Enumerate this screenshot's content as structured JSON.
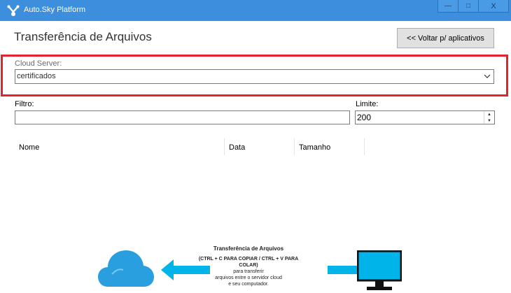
{
  "window": {
    "title": "Auto.Sky Platform",
    "minimize_glyph": "—",
    "maximize_glyph": "□",
    "close_glyph": "X"
  },
  "page": {
    "title": "Transferência de Arquivos",
    "back_button": "<< Voltar p/ aplicativos"
  },
  "cloud_server": {
    "label": "Cloud Server:",
    "selected": "certificados"
  },
  "filter": {
    "label": "Filtro:",
    "value": ""
  },
  "limit": {
    "label": "Limite:",
    "value": "200"
  },
  "file_list": {
    "columns": [
      "Nome",
      "Data",
      "Tamanho"
    ]
  },
  "info": {
    "title": "Transferência de Arquivos",
    "shortcut": "(CTRL + C PARA COPIAR / CTRL + V PARA COLAR)",
    "line1": "para transferir",
    "line2": "arquivos entre o servidor cloud",
    "line3": "e seu computador."
  },
  "colors": {
    "titlebar": "#3d8fde",
    "highlight": "#e2232b",
    "illustration_cyan": "#00b4ea",
    "cloud_blue": "#2a9fe0"
  },
  "icons": {
    "app": "app-logo-icon",
    "dropdown": "chevron-down-icon",
    "cloud": "cloud-icon",
    "monitor": "monitor-icon"
  }
}
